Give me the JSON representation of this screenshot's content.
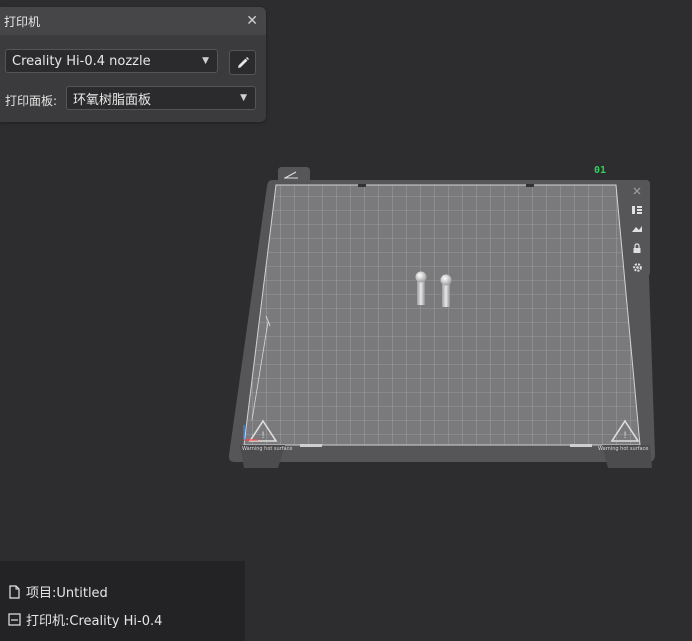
{
  "printer_panel": {
    "title": "打印机",
    "printer_select": "Creality Hi-0.4 nozzle",
    "plate_label": "打印面板:",
    "plate_select": "环氧树脂面板"
  },
  "plate": {
    "index_label": "01",
    "warning_text": "Warning hot surface"
  },
  "status": {
    "project": "项目:Untitled",
    "printer": "打印机:Creality Hi-0.4"
  }
}
